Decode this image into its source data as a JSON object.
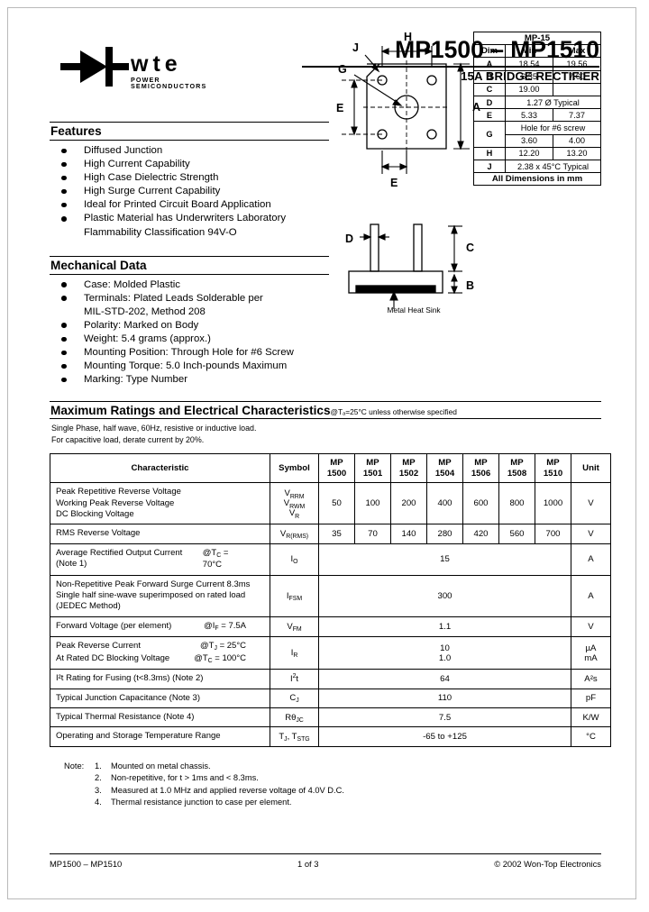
{
  "header": {
    "logo_text": "wte",
    "logo_subtext": "POWER SEMICONDUCTORS",
    "logo_icon": "diode-symbol-icon",
    "title": "MP1500 – MP1510",
    "subtitle": "15A BRIDGE RECTIFIER"
  },
  "features": {
    "heading": "Features",
    "items": [
      "Diffused Junction",
      "High Current Capability",
      "High Case Dielectric Strength",
      "High Surge Current Capability",
      "Ideal for Printed Circuit Board Application",
      "Plastic Material has Underwriters Laboratory\nFlammability Classification 94V-O"
    ]
  },
  "mechanical": {
    "heading": "Mechanical Data",
    "items": [
      "Case: Molded Plastic",
      "Terminals: Plated Leads Solderable per\nMIL-STD-202, Method 208",
      "Polarity: Marked on Body",
      "Weight: 5.4 grams (approx.)",
      "Mounting Position: Through Hole for #6 Screw",
      "Mounting Torque: 5.0 Inch-pounds Maximum",
      "Marking: Type Number"
    ]
  },
  "drawing": {
    "labels": {
      "H": "H",
      "J": "J",
      "G": "G",
      "E_left": "E",
      "E_bottom": "E",
      "A": "A",
      "D": "D",
      "C": "C",
      "B": "B"
    },
    "heat_sink_label": "Metal Heat Sink"
  },
  "dim_table": {
    "package": "MP-15",
    "columns": [
      "Dim",
      "Min",
      "Max"
    ],
    "rows": [
      {
        "dim": "A",
        "min": "18.54",
        "max": "19.56"
      },
      {
        "dim": "B",
        "min": "6.35",
        "max": "7.60"
      },
      {
        "dim": "C",
        "min": "19.00",
        "max": ""
      },
      {
        "dim": "D",
        "span": "1.27 Ø Typical"
      },
      {
        "dim": "E",
        "min": "5.33",
        "max": "7.37"
      },
      {
        "dim": "G",
        "span": "Hole for #6 screw",
        "min": "3.60",
        "max": "4.00"
      },
      {
        "dim": "H",
        "min": "12.20",
        "max": "13.20"
      },
      {
        "dim": "J",
        "span": "2.38 x 45°C Typical"
      }
    ],
    "footer": "All Dimensions in mm"
  },
  "ratings": {
    "title": "Maximum Ratings and Electrical Characteristics",
    "condition": "@Tₐ=25°C unless otherwise specified",
    "note_line1": "Single Phase, half wave, 60Hz, resistive or inductive load.",
    "note_line2": "For capacitive load, derate current by 20%.",
    "columns": {
      "characteristic": "Characteristic",
      "symbol": "Symbol",
      "parts": [
        {
          "l1": "MP",
          "l2": "1500"
        },
        {
          "l1": "MP",
          "l2": "1501"
        },
        {
          "l1": "MP",
          "l2": "1502"
        },
        {
          "l1": "MP",
          "l2": "1504"
        },
        {
          "l1": "MP",
          "l2": "1506"
        },
        {
          "l1": "MP",
          "l2": "1508"
        },
        {
          "l1": "MP",
          "l2": "1510"
        }
      ],
      "unit": "Unit"
    },
    "rows": [
      {
        "characteristic": [
          "Peak Repetitive Reverse Voltage",
          "Working Peak Reverse Voltage",
          "DC Blocking Voltage"
        ],
        "symbol_html": "V<sub>RRM</sub><br>V<sub>RWM</sub><br>V<sub>R</sub>",
        "values": [
          "50",
          "100",
          "200",
          "400",
          "600",
          "800",
          "1000"
        ],
        "unit": "V"
      },
      {
        "characteristic": [
          "RMS Reverse Voltage"
        ],
        "symbol_html": "V<sub>R(RMS)</sub>",
        "values": [
          "35",
          "70",
          "140",
          "280",
          "420",
          "560",
          "700"
        ],
        "unit": "V"
      },
      {
        "characteristic": [
          "Average Rectified Output Current (Note 1)"
        ],
        "condition_html": "@T<sub>C</sub> = 70°C",
        "symbol_html": "I<sub>O</sub>",
        "span_value": "15",
        "unit": "A"
      },
      {
        "characteristic": [
          "Non-Repetitive Peak Forward Surge Current 8.3ms",
          "Single half sine-wave superimposed on rated load",
          "(JEDEC Method)"
        ],
        "symbol_html": "I<sub>FSM</sub>",
        "span_value": "300",
        "unit": "A"
      },
      {
        "characteristic": [
          "Forward Voltage (per element)"
        ],
        "condition_html": "@I<sub>F</sub> = 7.5A",
        "symbol_html": "V<sub>FM</sub>",
        "span_value": "1.1",
        "unit": "V"
      },
      {
        "characteristic": [
          "Peak Reverse Current",
          "At Rated DC Blocking Voltage"
        ],
        "condition_html": "@T<sub>J</sub> = 25°C<br>@T<sub>C</sub> = 100°C",
        "symbol_html": "I<sub>R</sub>",
        "span_value": "10\n1.0",
        "unit": "µA\nmA"
      },
      {
        "characteristic": [
          "I²t Rating for Fusing (t<8.3ms) (Note 2)"
        ],
        "symbol_html": "I<sup>2</sup>t",
        "span_value": "64",
        "unit": "A²s"
      },
      {
        "characteristic": [
          "Typical Junction Capacitance (Note 3)"
        ],
        "symbol_html": "C<sub>J</sub>",
        "span_value": "110",
        "unit": "pF"
      },
      {
        "characteristic": [
          "Typical Thermal Resistance (Note 4)"
        ],
        "symbol_html": "Rθ<sub>JC</sub>",
        "span_value": "7.5",
        "unit": "K/W"
      },
      {
        "characteristic": [
          "Operating and Storage Temperature Range"
        ],
        "symbol_html": "T<sub>J</sub>, T<sub>STG</sub>",
        "span_value": "-65 to +125",
        "unit": "°C"
      }
    ]
  },
  "notes": {
    "label": "Note:",
    "items": [
      {
        "num": "1.",
        "text": "Mounted on metal chassis."
      },
      {
        "num": "2.",
        "text": "Non-repetitive, for t > 1ms and < 8.3ms."
      },
      {
        "num": "3.",
        "text": "Measured at 1.0 MHz and applied reverse voltage of 4.0V D.C."
      },
      {
        "num": "4.",
        "text": "Thermal resistance junction to case per element."
      }
    ]
  },
  "footer": {
    "left": "MP1500 – MP1510",
    "center": "1 of 3",
    "right": "© 2002 Won-Top Electronics"
  }
}
